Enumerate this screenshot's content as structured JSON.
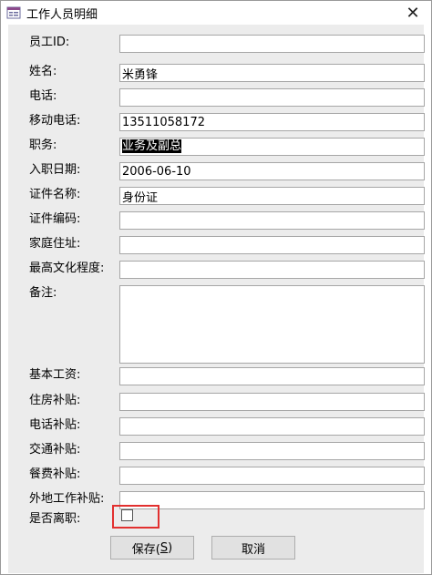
{
  "window": {
    "title": "工作人员明细",
    "close_glyph": "✕"
  },
  "fields": [
    {
      "label": "员工ID:",
      "value": ""
    },
    {
      "label": "姓名:",
      "value": "米勇锋"
    },
    {
      "label": "电话:",
      "value": ""
    },
    {
      "label": "移动电话:",
      "value": "13511058172"
    },
    {
      "label": "职务:",
      "value": "业务及副总"
    },
    {
      "label": "入职日期:",
      "value": "2006-06-10"
    },
    {
      "label": "证件名称:",
      "value": "身份证"
    },
    {
      "label": "证件编码:",
      "value": ""
    },
    {
      "label": "家庭住址:",
      "value": ""
    },
    {
      "label": "最高文化程度:",
      "value": ""
    },
    {
      "label": "备注:",
      "value": ""
    },
    {
      "label": "基本工资:",
      "value": ""
    },
    {
      "label": "住房补贴:",
      "value": ""
    },
    {
      "label": "电话补贴:",
      "value": ""
    },
    {
      "label": "交通补贴:",
      "value": ""
    },
    {
      "label": "餐费补贴:",
      "value": ""
    },
    {
      "label": "外地工作补贴:",
      "value": ""
    }
  ],
  "resigned": {
    "label": "是否离职:",
    "checked": false
  },
  "buttons": {
    "save_prefix": "保存(",
    "save_key": "S",
    "save_suffix": ")",
    "cancel": "取消"
  },
  "colors": {
    "highlight_border": "#e2302f",
    "form_background": "#ececec"
  }
}
